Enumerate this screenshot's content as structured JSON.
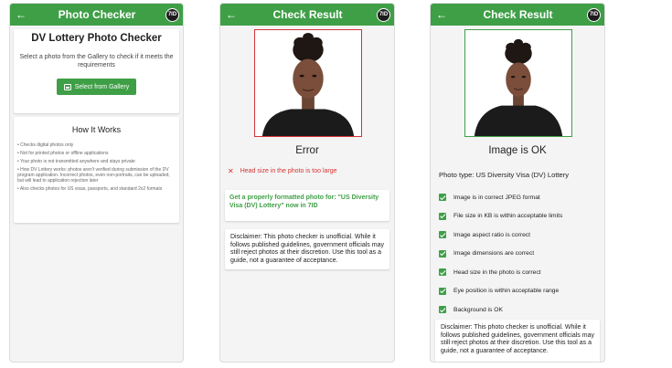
{
  "colors": {
    "primary": "#3f9f47",
    "error": "#d33434"
  },
  "logo_text": "7ID",
  "screen1": {
    "appbar_title": "Photo Checker",
    "title": "DV Lottery Photo Checker",
    "description": "Select a photo from the Gallery to check if it meets the requirements",
    "button_label": "Select from Gallery",
    "how_title": "How It Works",
    "how_items": [
      "Checks digital photos only",
      "Not for printed photos or offline applications",
      "Your photo is not transmitted anywhere and stays private",
      "How DV Lottery works: photos aren't verified during submission of the DV program application. Incorrect photos, even non-portraits, can be uploaded, but will lead to application rejection later",
      "Also checks photos for US visas, passports, and standard 2x2 formats"
    ]
  },
  "screen2": {
    "appbar_title": "Check Result",
    "result_title": "Error",
    "error_text": "Head size in the photo is too large",
    "promo_text": "Get a properly formatted photo for: \"US Diversity Visa (DV) Lottery\" now in 7ID",
    "disclaimer": "Disclaimer: This photo checker is unofficial. While it follows published guidelines, government officials may still reject photos at their discretion. Use this tool as a guide, not a guarantee of acceptance."
  },
  "screen3": {
    "appbar_title": "Check Result",
    "result_title": "Image is OK",
    "photo_type": "Photo type: US Diversity Visa (DV) Lottery",
    "checks": [
      "Image is in correct JPEG format",
      "File size in KB is within acceptable limits",
      "Image aspect ratio is correct",
      "Image dimensions are correct",
      "Head size in the photo is correct",
      "Eye position is within acceptable range",
      "Background is OK"
    ],
    "disclaimer": "Disclaimer: This photo checker is unofficial. While it follows published guidelines, government officials may still reject photos at their discretion. Use this tool as a guide, not a guarantee of acceptance."
  }
}
